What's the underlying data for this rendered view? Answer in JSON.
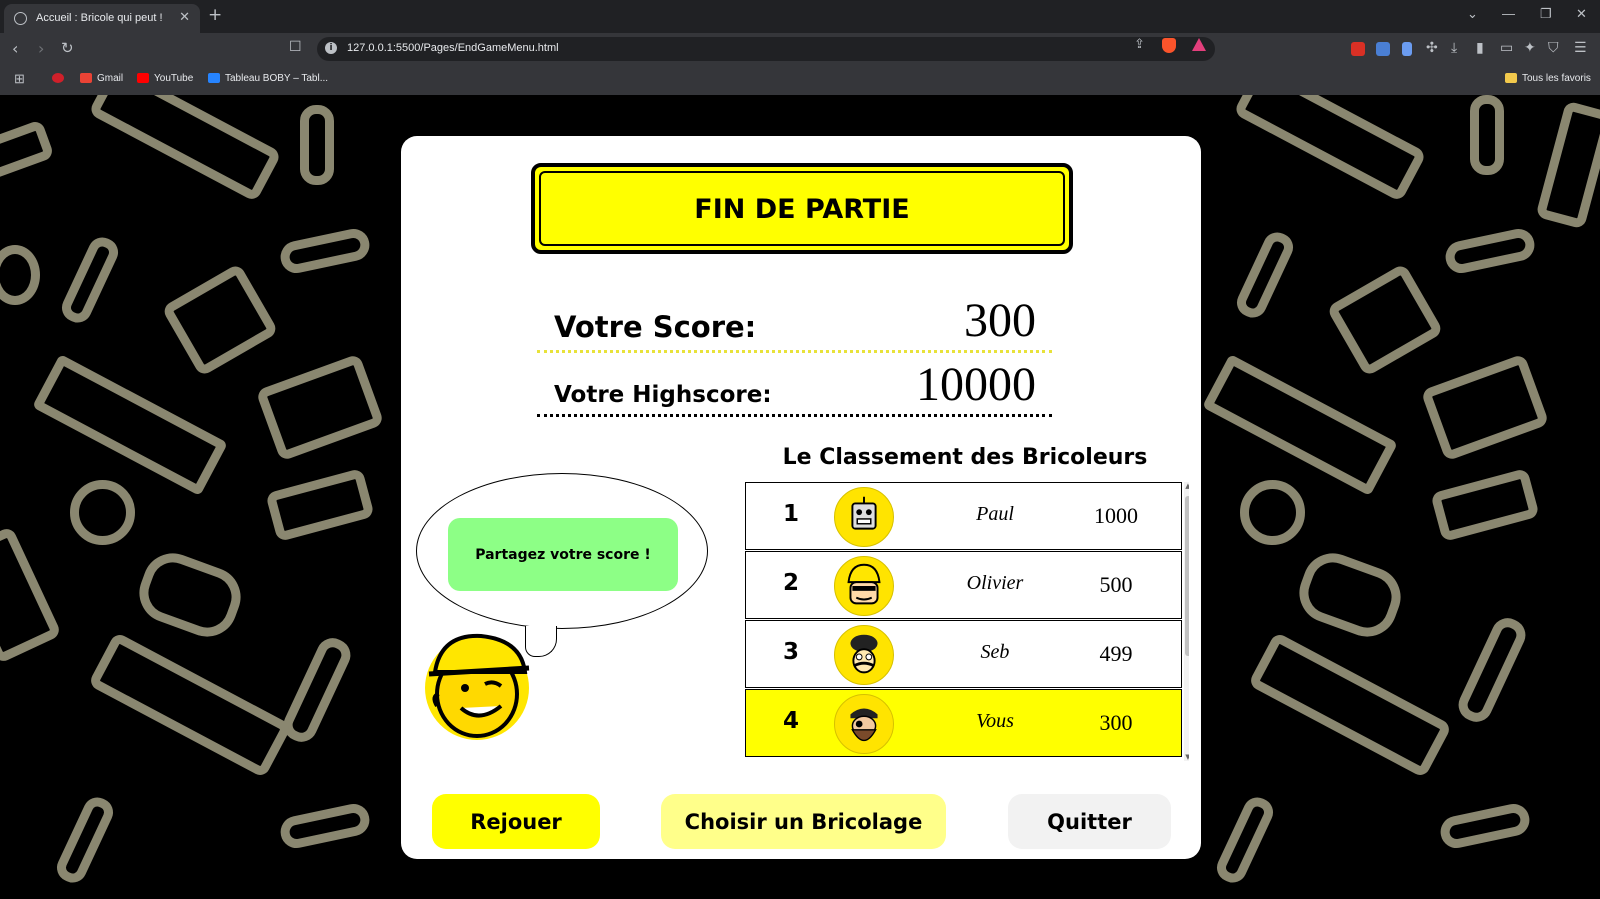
{
  "browser": {
    "tab_title": "Accueil : Bricole qui peut !",
    "tab_close": "✕",
    "new_tab": "+",
    "url": "127.0.0.1:5500/Pages/EndGameMenu.html",
    "bookmarks": [
      {
        "label": "Gmail",
        "icon": "gmail-icon"
      },
      {
        "label": "YouTube",
        "icon": "youtube-icon"
      },
      {
        "label": "Tableau BOBY – Tabl...",
        "icon": "atlassian-icon"
      }
    ],
    "all_favorites": "Tous les favoris"
  },
  "page": {
    "header_title": "FIN DE PARTIE",
    "score_label": "Votre Score:",
    "score_value": "300",
    "highscore_label": "Votre Highscore:",
    "highscore_value": "10000",
    "share_label": "Partagez votre score !",
    "ranking_title": "Le Classement des Bricoleurs",
    "ranking": [
      {
        "rank": "1",
        "name": "Paul",
        "score": "1000",
        "avatar": "robot-avatar",
        "highlight": false
      },
      {
        "rank": "2",
        "name": "Olivier",
        "score": "500",
        "avatar": "builder-avatar",
        "highlight": false
      },
      {
        "rank": "3",
        "name": "Seb",
        "score": "499",
        "avatar": "mustache-avatar",
        "highlight": false
      },
      {
        "rank": "4",
        "name": "Vous",
        "score": "300",
        "avatar": "pirate-avatar",
        "highlight": true
      }
    ],
    "buttons": {
      "replay": "Rejouer",
      "choose": "Choisir un Bricolage",
      "quit": "Quitter"
    }
  },
  "colors": {
    "accent_yellow": "#ffff00",
    "light_yellow": "#ffff8a",
    "share_green": "#8dff86",
    "background_pattern": "#8a8770"
  }
}
